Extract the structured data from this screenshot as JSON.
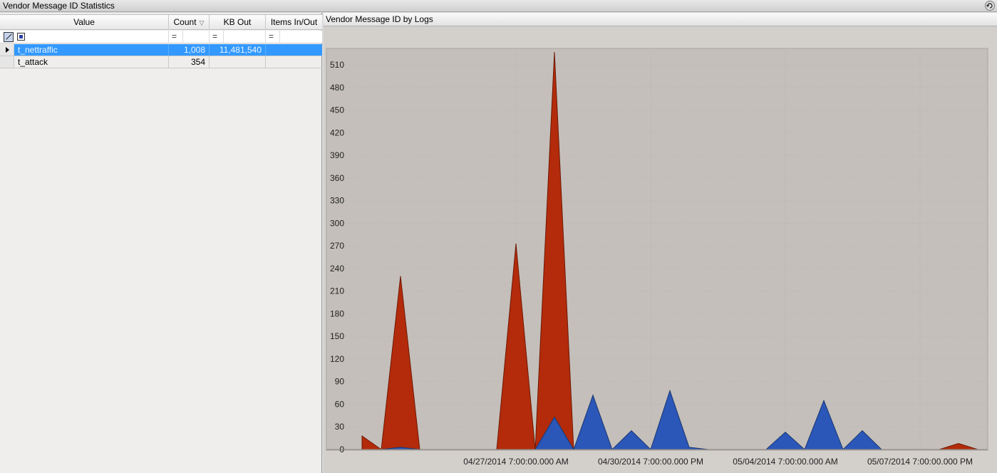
{
  "window": {
    "title": "Vendor Message ID Statistics"
  },
  "icons": {
    "refresh": "refresh-icon",
    "filter": "filter-icon",
    "sort": "sort-descending-icon",
    "row_pointer": "row-pointer-icon"
  },
  "grid": {
    "columns": [
      "Value",
      "Count",
      "KB Out",
      "Items In/Out"
    ],
    "sort_glyph": "▽",
    "filter_operator": "=",
    "rows": [
      {
        "value": "t_nettraffic",
        "count": "1,008",
        "kb_out": "11,481,540",
        "items": "",
        "selected": true
      },
      {
        "value": "t_attack",
        "count": "354",
        "kb_out": "",
        "items": "",
        "selected": false
      }
    ]
  },
  "chart_panel": {
    "title": "Vendor Message ID by Logs"
  },
  "colors": {
    "selection": "#3399ff",
    "series_red": "#b32b0b",
    "series_blue": "#2b57b8",
    "plot_background": "#c4bfba"
  },
  "chart_data": {
    "type": "area",
    "ylim": [
      0,
      530
    ],
    "yticks": [
      0,
      30,
      60,
      90,
      120,
      150,
      180,
      210,
      240,
      270,
      300,
      330,
      360,
      390,
      420,
      450,
      480,
      510
    ],
    "xtick_labels": [
      "04/27/2014 7:00:00.000 AM",
      "04/30/2014 7:00:00.000 PM",
      "05/04/2014 7:00:00.000 AM",
      "05/07/2014 7:00:00.000 PM"
    ],
    "xlim_index": [
      0,
      32
    ],
    "xtick_positions_index": [
      8,
      15,
      22,
      29
    ],
    "grid": true,
    "series": [
      {
        "color": "#b32b0b",
        "values": [
          18,
          0,
          230,
          0,
          0,
          0,
          0,
          0,
          273,
          0,
          527,
          0,
          0,
          0,
          0,
          0,
          3,
          0,
          0,
          0,
          0,
          0,
          0,
          0,
          0,
          0,
          0,
          0,
          0,
          0,
          0,
          8,
          0
        ]
      },
      {
        "color": "#2b57b8",
        "values": [
          0,
          0,
          3,
          0,
          0,
          0,
          0,
          0,
          0,
          0,
          43,
          0,
          72,
          0,
          25,
          0,
          78,
          3,
          0,
          0,
          0,
          0,
          23,
          0,
          65,
          0,
          25,
          0,
          0,
          0,
          0,
          0,
          0
        ]
      }
    ]
  }
}
